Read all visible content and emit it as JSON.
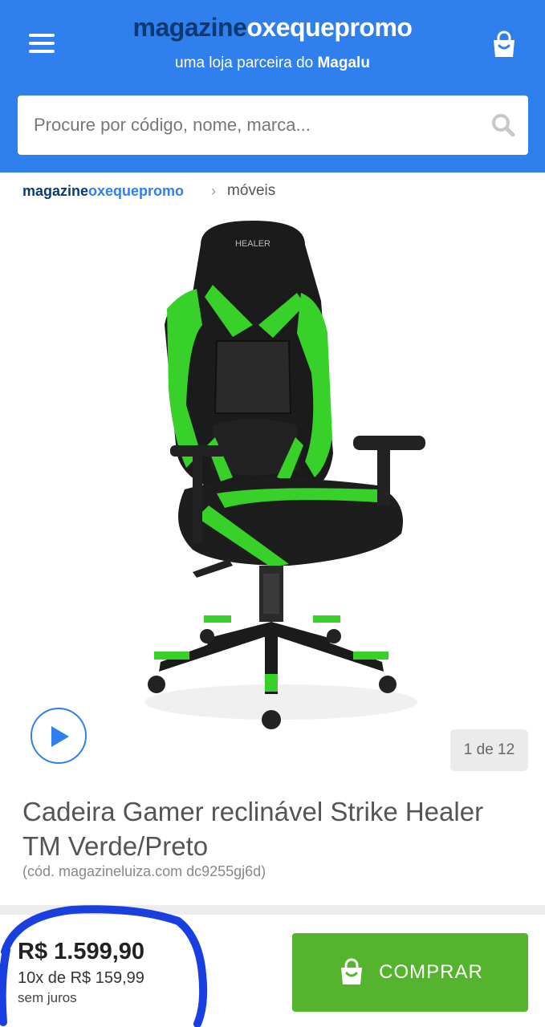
{
  "header": {
    "logo_prefix": "magazine",
    "logo_store": "oxequepromo",
    "tagline_prefix": "uma loja parceira do ",
    "tagline_brand": "Magalu",
    "menu_icon": "hamburger-menu-icon",
    "bag_icon": "shopping-bag-icon",
    "accent_color": "#2f80ed"
  },
  "search": {
    "placeholder": "Procure por código, nome, marca...",
    "value": "",
    "icon": "search-icon"
  },
  "breadcrumb": {
    "store_prefix": "magazine",
    "store_name": "oxequepromo",
    "separator": "›",
    "category": "móveis"
  },
  "gallery": {
    "product_image": "gaming-chair-green-black",
    "brand_on_headrest": "HEALER",
    "play_icon": "play-video-icon",
    "counter": "1 de 12"
  },
  "product": {
    "title": "Cadeira Gamer reclinável Strike Healer TM Verde/Preto",
    "code": "(cód. magazineluiza.com dc9255gj6d)"
  },
  "purchase": {
    "price": "R$ 1.599,90",
    "installments": "10x de R$ 159,99",
    "interest": "sem juros",
    "buy_label": "COMPRAR",
    "buy_color": "#54b42e",
    "highlight_color": "#1a3fe0"
  }
}
